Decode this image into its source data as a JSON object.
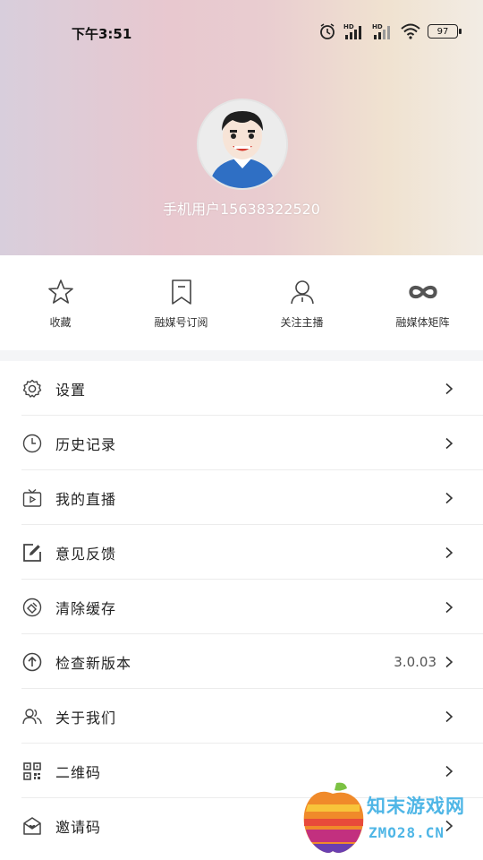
{
  "status_bar": {
    "time": "下午3:51",
    "battery": "97",
    "icons": [
      "alarm-icon",
      "signal-hd-icon",
      "signal-hd-icon",
      "wifi-icon",
      "battery-icon"
    ]
  },
  "profile": {
    "username": "手机用户15638322520",
    "avatar_icon": "cartoon-avatar"
  },
  "quick_actions": [
    {
      "label": "收藏",
      "icon": "star-icon"
    },
    {
      "label": "融媒号订阅",
      "icon": "bookmark-icon"
    },
    {
      "label": "关注主播",
      "icon": "person-icon"
    },
    {
      "label": "融媒体矩阵",
      "icon": "infinity-icon"
    }
  ],
  "menu": [
    {
      "label": "设置",
      "icon": "gear-icon",
      "value": ""
    },
    {
      "label": "历史记录",
      "icon": "clock-icon",
      "value": ""
    },
    {
      "label": "我的直播",
      "icon": "tv-icon",
      "value": ""
    },
    {
      "label": "意见反馈",
      "icon": "edit-icon",
      "value": ""
    },
    {
      "label": "清除缓存",
      "icon": "clear-cache-icon",
      "value": ""
    },
    {
      "label": "检查新版本",
      "icon": "upload-icon",
      "value": "3.0.03"
    },
    {
      "label": "关于我们",
      "icon": "people-icon",
      "value": ""
    },
    {
      "label": "二维码",
      "icon": "qrcode-icon",
      "value": ""
    },
    {
      "label": "邀请码",
      "icon": "invite-icon",
      "value": ""
    }
  ],
  "watermark": {
    "line1": "知末游戏网",
    "line2": "ZMO28.CN"
  },
  "colors": {
    "watermark_blue": "#4fb6e6",
    "divider": "#ececec"
  }
}
